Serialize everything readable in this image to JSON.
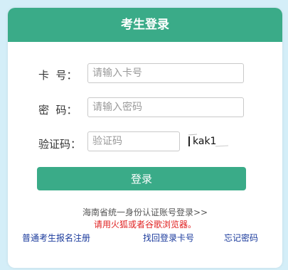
{
  "header": {
    "title": "考生登录"
  },
  "form": {
    "card_label": "卡  号：",
    "card_placeholder": "请输入卡号",
    "password_label": "密  码：",
    "password_placeholder": "请输入密码",
    "captcha_label": "验证码：",
    "captcha_placeholder": "验证码",
    "captcha_text": "kak1"
  },
  "login_button": "登录",
  "unified_login": "海南省统一身份认证账号登录>>",
  "browser_note": "请用火狐或者谷歌浏览器。",
  "links": {
    "register": "普通考生报名注册",
    "recover_card": "找回登录卡号",
    "forgot_password": "忘记密码"
  },
  "colors": {
    "accent": "#3aab88",
    "background": "#d4eef8",
    "link": "#1a3a9c",
    "warning": "#e02020"
  }
}
